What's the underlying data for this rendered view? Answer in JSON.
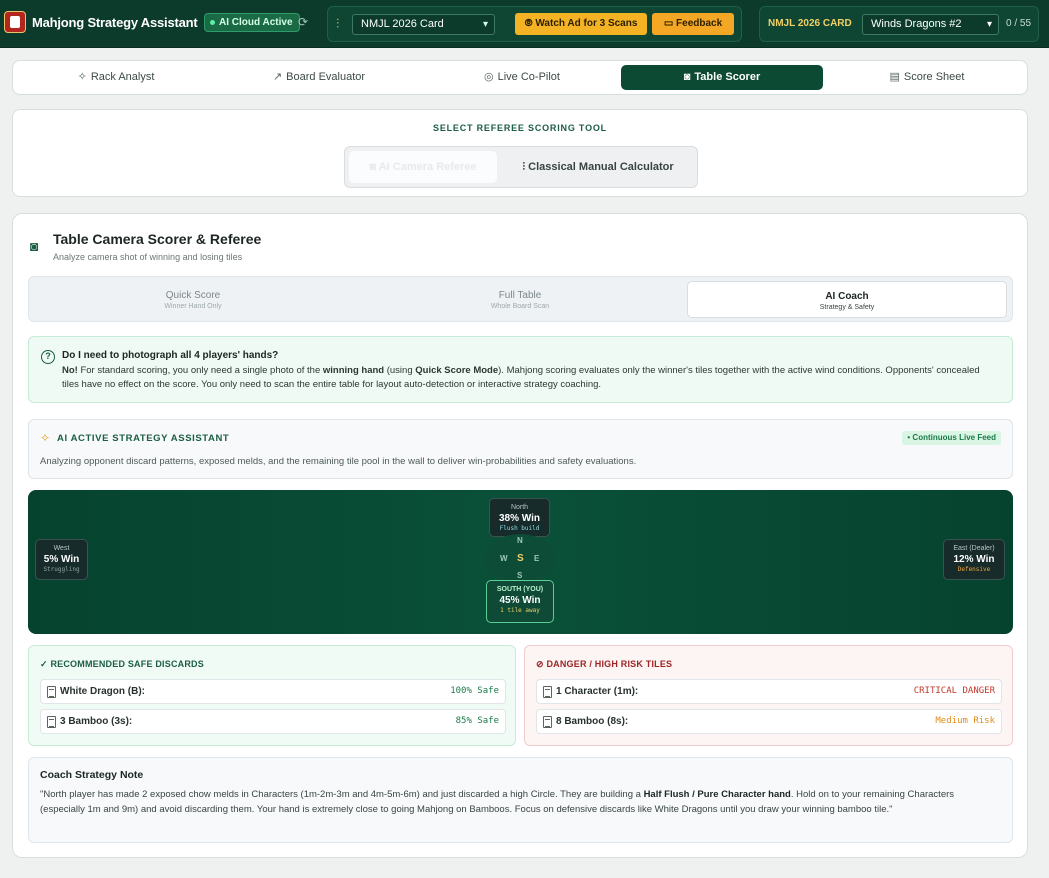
{
  "header": {
    "app_title": "Mahjong Strategy Assistant",
    "cloud_status": "AI Cloud Active",
    "card_select_value": "NMJL 2026 Card",
    "watch_ad_label": "Watch Ad for 3 Scans",
    "feedback_label": "Feedback",
    "card_label": "NMJL 2026 CARD",
    "hand_select_value": "Winds Dragons #2",
    "hand_count": "0 / 55"
  },
  "nav": {
    "tabs": [
      {
        "label": "Rack Analyst",
        "icon": "sparkles-icon"
      },
      {
        "label": "Board Evaluator",
        "icon": "trend-icon"
      },
      {
        "label": "Live Co-Pilot",
        "icon": "compass-icon"
      },
      {
        "label": "Table Scorer",
        "icon": "camera-icon",
        "active": true
      },
      {
        "label": "Score Sheet",
        "icon": "receipt-icon"
      }
    ]
  },
  "referee": {
    "title": "SELECT REFEREE SCORING TOOL",
    "options": [
      "AI Camera Referee",
      "Classical Manual Calculator"
    ]
  },
  "camera": {
    "title": "Table Camera Scorer & Referee",
    "subtitle": "Analyze camera shot of winning and losing tiles",
    "modes": [
      {
        "title": "Quick Score",
        "subtitle": "Winner Hand Only"
      },
      {
        "title": "Full Table",
        "subtitle": "Whole Board Scan"
      },
      {
        "title": "AI Coach",
        "subtitle": "Strategy & Safety",
        "active": true
      }
    ],
    "info": {
      "question": "Do I need to photograph all 4 players' hands?",
      "answer_lead": "No!",
      "answer_p1": " For standard scoring, you only need a single photo of the ",
      "answer_b1": "winning hand",
      "answer_p2": " (using ",
      "answer_b2": "Quick Score Mode",
      "answer_p3": "). Mahjong scoring evaluates only the winner's tiles together with the active wind conditions. Opponents' concealed tiles have no effect on the score. You only need to scan the entire table for layout auto-detection or interactive strategy coaching."
    },
    "strategy": {
      "title": "AI ACTIVE STRATEGY ASSISTANT",
      "badge": "• Continuous Live Feed",
      "description": "Analyzing opponent discard patterns, exposed melds, and the remaining tile pool in the wall to deliver win-probabilities and safety evaluations."
    },
    "board": {
      "north": {
        "name": "North",
        "pct": "38% Win",
        "status": "Flush build"
      },
      "west": {
        "name": "West",
        "pct": "5% Win",
        "status": "Struggling"
      },
      "east": {
        "name": "East (Dealer)",
        "pct": "12% Win",
        "status": "Defensive"
      },
      "south": {
        "name": "SOUTH (YOU)",
        "pct": "45% Win",
        "status": "1 tile away"
      },
      "compass": {
        "n": "N",
        "w": "W",
        "c": "S",
        "e": "E",
        "s": "S"
      }
    },
    "safe": {
      "title": "RECOMMENDED SAFE DISCARDS",
      "rows": [
        {
          "tile": "White Dragon (B):",
          "value": "100% Safe"
        },
        {
          "tile": "3 Bamboo (3s):",
          "value": "85% Safe"
        }
      ]
    },
    "danger": {
      "title": "DANGER / HIGH RISK TILES",
      "rows": [
        {
          "tile": "1 Character (1m):",
          "value": "CRITICAL DANGER"
        },
        {
          "tile": "8 Bamboo (8s):",
          "value": "Medium Risk"
        }
      ]
    },
    "coach": {
      "title": "Coach Strategy Note",
      "p1": "\"North player has made 2 exposed chow melds in Characters (1m-2m-3m and 4m-5m-6m) and just discarded a high Circle. They are building a ",
      "b1": "Half Flush / Pure Character hand",
      "p2": ". Hold on to your remaining Characters (especially 1m and 9m) and avoid discarding them. Your hand is extremely close to going Mahjong on Bamboos. Focus on defensive discards like White Dragons until you draw your winning bamboo tile.\""
    }
  },
  "colors": {
    "brand_dark": "#0c3b2b",
    "accent_gold": "#f4b225",
    "safe_green": "#1b7a4a",
    "danger_red": "#c0392b",
    "risk_orange": "#e08a1a"
  }
}
